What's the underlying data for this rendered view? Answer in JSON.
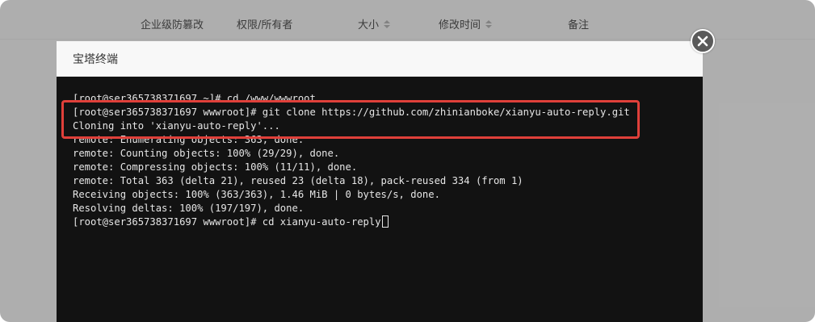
{
  "background_table": {
    "columns": [
      {
        "label": "企业级防篡改",
        "sortable": false
      },
      {
        "label": "权限/所有者",
        "sortable": false
      },
      {
        "label": "大小",
        "sortable": true
      },
      {
        "label": "修改时间",
        "sortable": true
      },
      {
        "label": "备注",
        "sortable": false
      }
    ]
  },
  "dialog": {
    "title": "宝塔终端",
    "close_icon": "close-circle-icon"
  },
  "terminal": {
    "lines": [
      "[root@ser365738371697 ~]# cd /www/wwwroot",
      "[root@ser365738371697 wwwroot]# git clone https://github.com/zhinianboke/xianyu-auto-reply.git",
      "Cloning into 'xianyu-auto-reply'...",
      "remote: Enumerating objects: 363, done.",
      "remote: Counting objects: 100% (29/29), done.",
      "remote: Compressing objects: 100% (11/11), done.",
      "remote: Total 363 (delta 21), reused 23 (delta 18), pack-reused 334 (from 1)",
      "Receiving objects: 100% (363/363), 1.46 MiB | 0 bytes/s, done.",
      "Resolving deltas: 100% (197/197), done.",
      "[root@ser365738371697 wwwroot]# cd xianyu-auto-reply"
    ],
    "highlight_color": "#e0403a"
  }
}
